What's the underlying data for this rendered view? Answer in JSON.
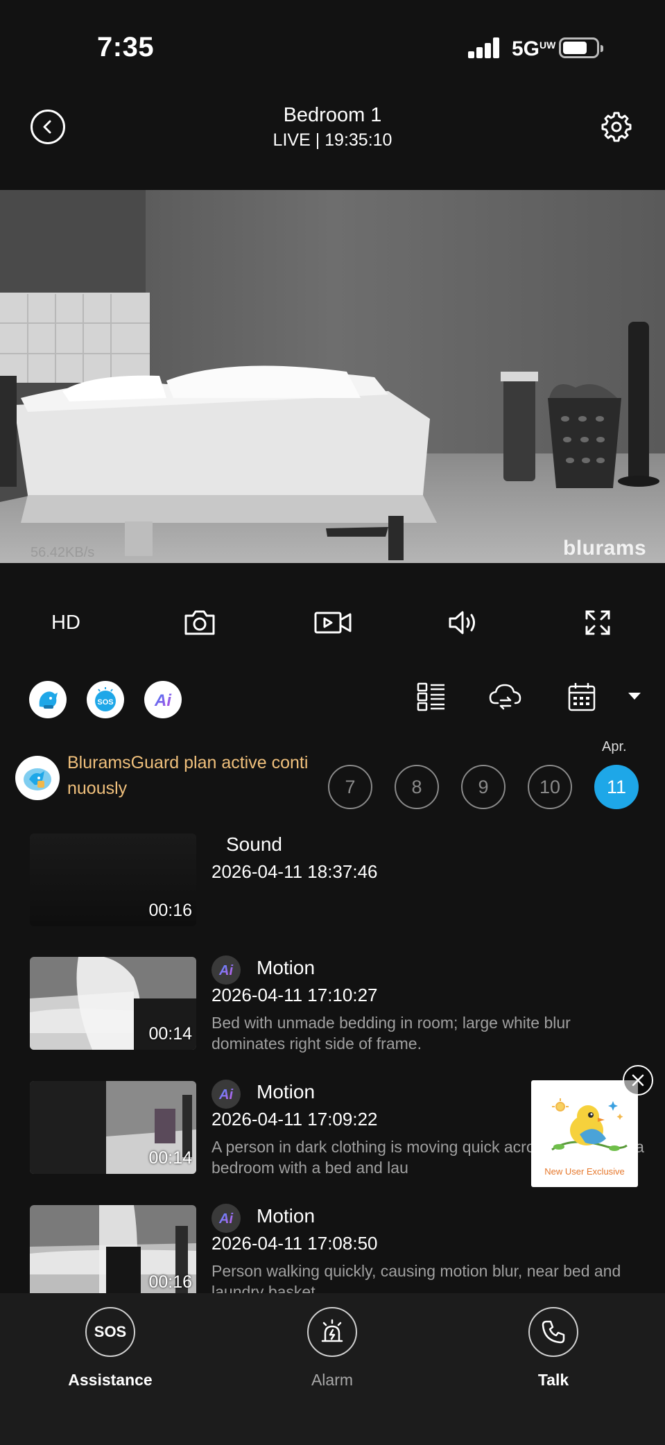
{
  "status": {
    "time": "7:35",
    "network": "5G",
    "network_sup": "UW"
  },
  "header": {
    "title": "Bedroom 1",
    "subtitle": "LIVE | 19:35:10"
  },
  "video": {
    "bitrate": "56.42KB/s",
    "watermark": "blurams"
  },
  "toolbar": {
    "quality": "HD"
  },
  "plan": {
    "text": "BluramsGuard plan active continuously"
  },
  "calendar": {
    "month": "Apr.",
    "days": [
      "7",
      "8",
      "9",
      "10",
      "11"
    ],
    "selected_day": "11"
  },
  "events": [
    {
      "type": "Sound",
      "time": "2026-04-11 18:37:46",
      "duration": "00:16",
      "ai": false,
      "desc": ""
    },
    {
      "type": "Motion",
      "time": "2026-04-11 17:10:27",
      "duration": "00:14",
      "ai": true,
      "desc": "Bed with unmade bedding in room; large white blur dominates right side of frame."
    },
    {
      "type": "Motion",
      "time": "2026-04-11 17:09:22",
      "duration": "00:14",
      "ai": true,
      "desc": "A person in dark clothing is moving quick across the view in a bedroom with a bed and lau"
    },
    {
      "type": "Motion",
      "time": "2026-04-11 17:08:50",
      "duration": "00:16",
      "ai": true,
      "desc": "Person walking quickly, causing motion blur, near bed and laundry basket."
    }
  ],
  "promo": {
    "label": "New User Exclusive"
  },
  "bottom": {
    "assistance": "Assistance",
    "alarm": "Alarm",
    "talk": "Talk",
    "sos_text": "SOS"
  },
  "colors": {
    "accent": "#1ea7e8",
    "plan_text": "#f0c07c",
    "background": "#121212"
  }
}
